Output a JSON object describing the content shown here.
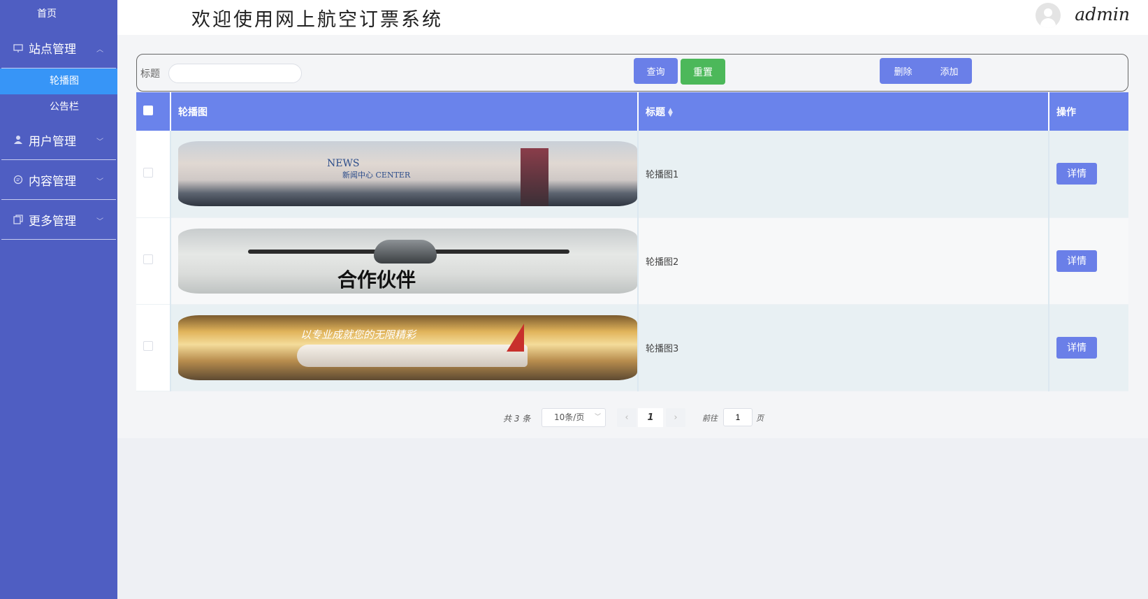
{
  "sidebar": {
    "home": "首页",
    "groups": [
      {
        "label": "站点管理",
        "icon": "monitor-icon",
        "expanded": true,
        "items": [
          {
            "label": "轮播图",
            "active": true
          },
          {
            "label": "公告栏",
            "active": false
          }
        ]
      },
      {
        "label": "用户管理",
        "icon": "user-icon",
        "expanded": false
      },
      {
        "label": "内容管理",
        "icon": "comment-icon",
        "expanded": false
      },
      {
        "label": "更多管理",
        "icon": "copy-icon",
        "expanded": false
      }
    ]
  },
  "header": {
    "title": "欢迎使用网上航空订票系统",
    "username": "admin"
  },
  "filter": {
    "title_label": "标题",
    "title_value": "",
    "query_button": "查询",
    "reset_button": "重置",
    "delete_button": "删除",
    "add_button": "添加"
  },
  "table": {
    "columns": {
      "image": "轮播图",
      "title": "标题",
      "actions": "操作"
    },
    "rows": [
      {
        "banner_text_line1": "NEWS",
        "banner_text_line2": "新闻中心 CENTER",
        "title": "轮播图1",
        "action": "详情"
      },
      {
        "banner_text_line1": "合作伙伴",
        "title": "轮播图2",
        "action": "详情"
      },
      {
        "banner_text_line1": "以专业成就您的无限精彩",
        "title": "轮播图3",
        "action": "详情"
      }
    ]
  },
  "pagination": {
    "total": "共 3 条",
    "page_size": "10条/页",
    "current_page": "1",
    "goto_label": "前往",
    "goto_value": "1",
    "page_suffix": "页"
  },
  "colors": {
    "sidebar_bg": "#4f5ec2",
    "sidebar_active": "#3795f7",
    "primary": "#6a7fe8",
    "success": "#4cb85a",
    "table_header": "#6a83eb"
  }
}
